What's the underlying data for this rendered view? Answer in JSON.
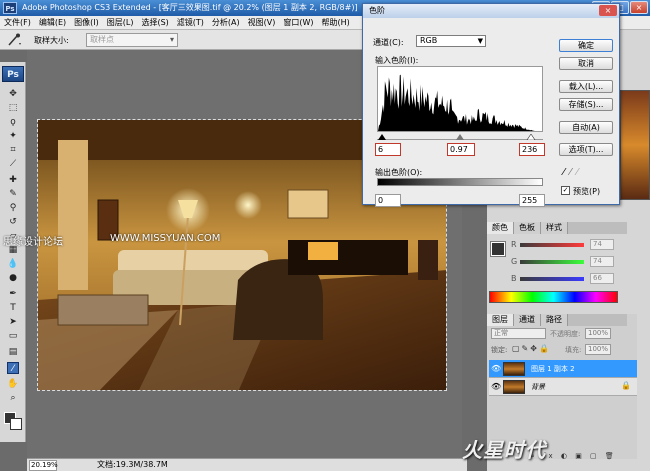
{
  "window": {
    "title": "Adobe Photoshop CS3 Extended - [客厅三效果图.tif @ 20.2% (图层 1 副本 2, RGB/8#)]"
  },
  "menu": [
    "文件(F)",
    "编辑(E)",
    "图像(I)",
    "图层(L)",
    "选择(S)",
    "滤镜(T)",
    "分析(A)",
    "视图(V)",
    "窗口(W)",
    "帮助(H)"
  ],
  "options": {
    "sample_label": "取样大小:",
    "sample_value": "取样点"
  },
  "levels": {
    "title": "色阶",
    "channel_label": "通道(C):",
    "channel_value": "RGB",
    "input_label": "输入色阶(I):",
    "input_black": "6",
    "input_gamma": "0.97",
    "input_white": "236",
    "output_label": "输出色阶(O):",
    "output_black": "0",
    "output_white": "255",
    "buttons": {
      "ok": "确定",
      "cancel": "取消",
      "load": "载入(L)...",
      "save": "存储(S)...",
      "auto": "自动(A)",
      "options": "选项(T)..."
    },
    "preview_label": "预览(P)",
    "preview_checked": "✓"
  },
  "color_panel": {
    "tabs": [
      "颜色",
      "色板",
      "样式"
    ],
    "channels": [
      {
        "label": "R",
        "value": "74"
      },
      {
        "label": "G",
        "value": "74"
      },
      {
        "label": "B",
        "value": "66"
      }
    ]
  },
  "layers_panel": {
    "tabs": [
      "图层",
      "通道",
      "路径"
    ],
    "blend_mode": "正常",
    "opacity_label": "不透明度:",
    "opacity": "100%",
    "lock_label": "锁定:",
    "fill_label": "填充:",
    "fill": "100%",
    "layers": [
      {
        "name": "图层 1 副本 2",
        "selected": true
      },
      {
        "name": "背景",
        "selected": false
      }
    ]
  },
  "status": {
    "zoom": "20.19%",
    "doc": "文档:19.3M/38.7M"
  },
  "watermarks": {
    "left": "思缘设计论坛",
    "url": "WWW.MISSYUAN.COM",
    "brand": "火星时代"
  },
  "colors": {
    "title_bar": "#1e5ba8",
    "selected_layer": "#3399ff",
    "highlight_red": "#c0392b"
  }
}
